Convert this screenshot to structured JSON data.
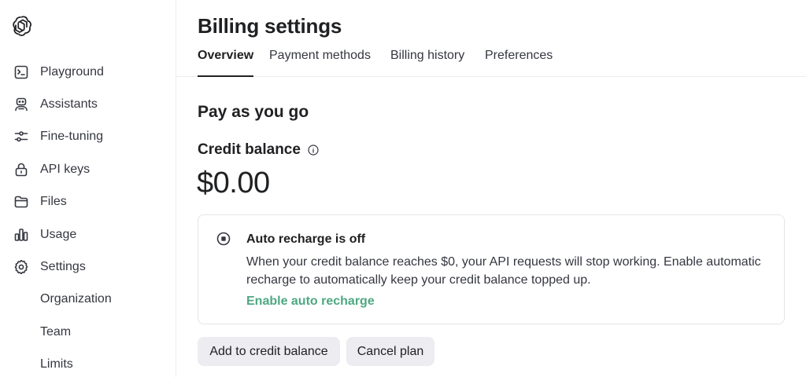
{
  "sidebar": {
    "items": [
      {
        "label": "Playground",
        "icon": "terminal-icon"
      },
      {
        "label": "Assistants",
        "icon": "robot-icon"
      },
      {
        "label": "Fine-tuning",
        "icon": "sliders-icon"
      },
      {
        "label": "API keys",
        "icon": "lock-icon"
      },
      {
        "label": "Files",
        "icon": "folder-icon"
      },
      {
        "label": "Usage",
        "icon": "bar-chart-icon"
      },
      {
        "label": "Settings",
        "icon": "gear-icon"
      }
    ],
    "sub_items": [
      {
        "label": "Organization"
      },
      {
        "label": "Team"
      },
      {
        "label": "Limits"
      }
    ]
  },
  "page": {
    "title": "Billing settings",
    "tabs": [
      {
        "label": "Overview",
        "active": true
      },
      {
        "label": "Payment methods",
        "active": false
      },
      {
        "label": "Billing history",
        "active": false
      },
      {
        "label": "Preferences",
        "active": false
      }
    ]
  },
  "overview": {
    "plan_title": "Pay as you go",
    "credit_label": "Credit balance",
    "balance": "$0.00",
    "auto_recharge": {
      "title": "Auto recharge is off",
      "description": "When your credit balance reaches $0, your API requests will stop working. Enable automatic recharge to automatically keep your credit balance topped up.",
      "link": "Enable auto recharge"
    },
    "buttons": {
      "add": "Add to credit balance",
      "cancel": "Cancel plan"
    }
  },
  "colors": {
    "accent_link": "#4ea882",
    "button_bg": "#ececf1",
    "border": "#ececf1"
  }
}
